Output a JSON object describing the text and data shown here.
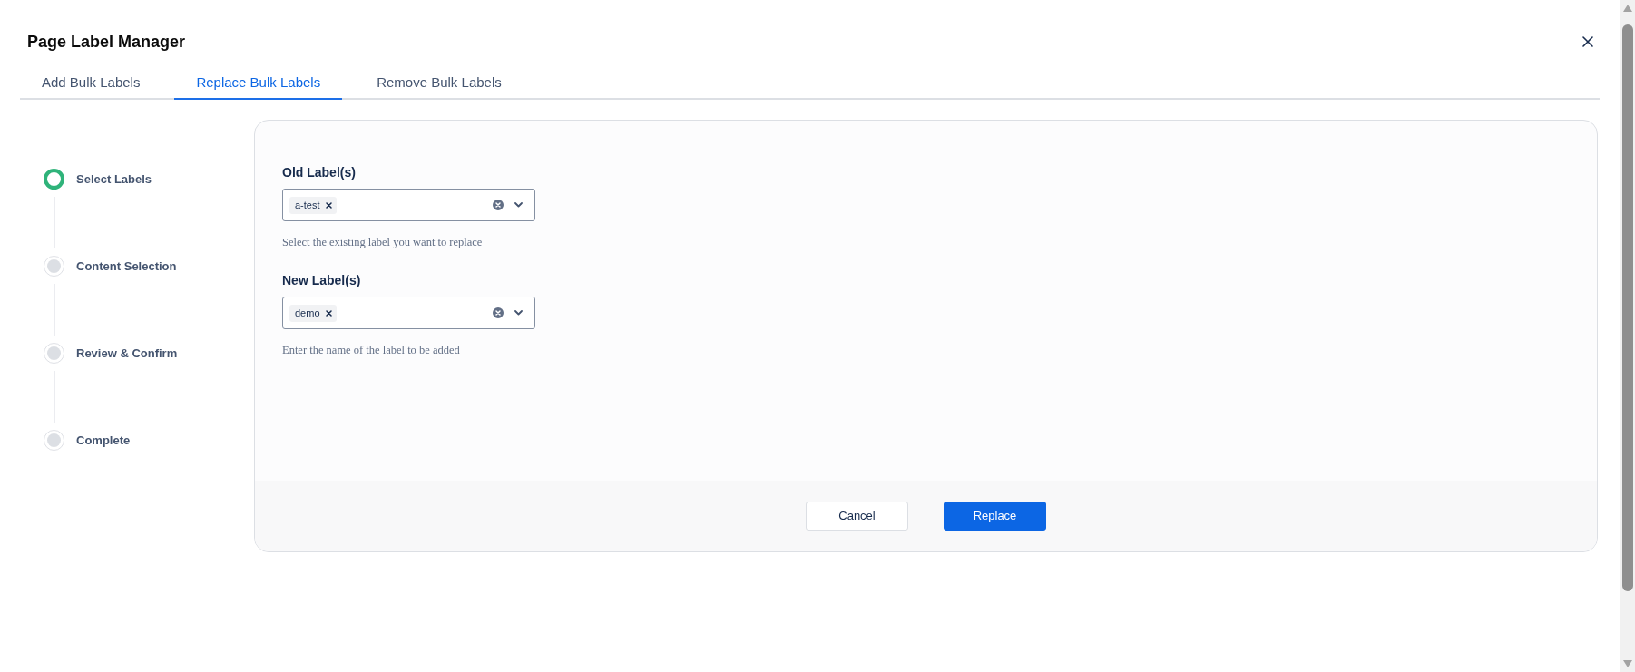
{
  "dialog": {
    "title": "Page Label Manager"
  },
  "tabs": [
    {
      "label": "Add Bulk Labels",
      "selected": false
    },
    {
      "label": "Replace Bulk Labels",
      "selected": true
    },
    {
      "label": "Remove Bulk Labels",
      "selected": false
    }
  ],
  "steps": [
    {
      "label": "Select Labels",
      "current": true
    },
    {
      "label": "Content Selection",
      "current": false
    },
    {
      "label": "Review & Confirm",
      "current": false
    },
    {
      "label": "Complete",
      "current": false
    }
  ],
  "fields": [
    {
      "label": "Old Label(s)",
      "tags": [
        "a-test"
      ],
      "help": "Select the existing label you want to replace"
    },
    {
      "label": "New Label(s)",
      "tags": [
        "demo"
      ],
      "help": "Enter the name of the label to be added"
    }
  ],
  "buttons": [
    {
      "label": "Cancel",
      "kind": "secondary"
    },
    {
      "label": "Replace",
      "kind": "primary"
    }
  ]
}
